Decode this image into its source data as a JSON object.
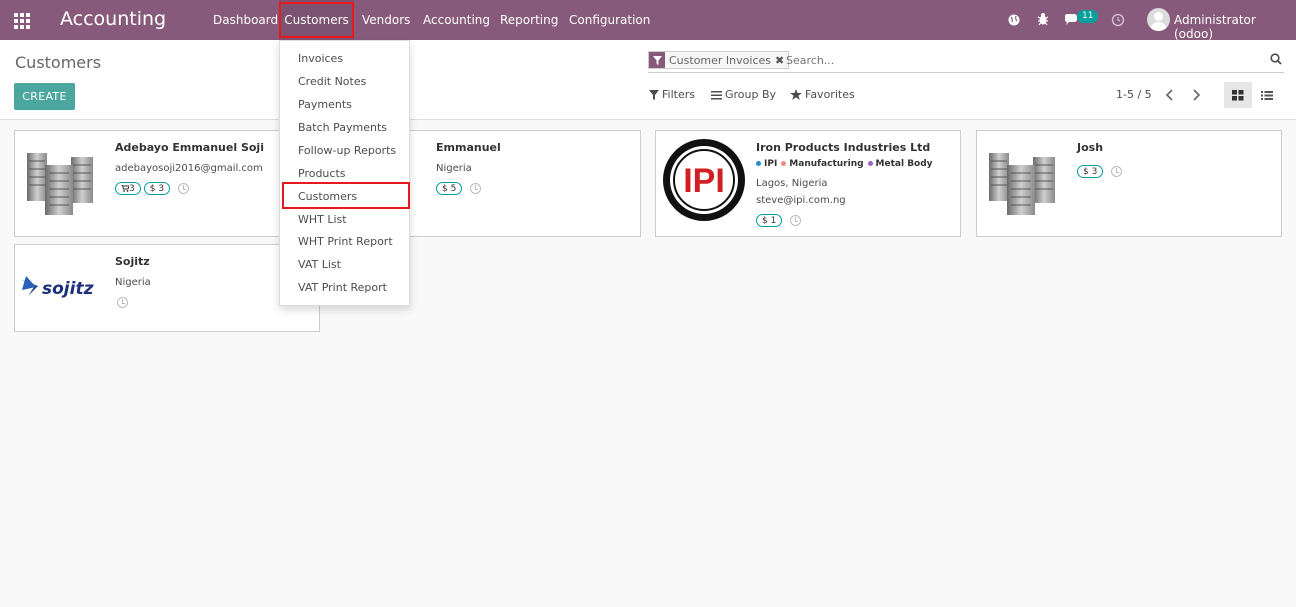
{
  "navbar": {
    "app_title": "Accounting",
    "menus": [
      "Dashboard",
      "Customers",
      "Vendors",
      "Accounting",
      "Reporting",
      "Configuration"
    ],
    "active_menu": "Customers",
    "messages_count": "11",
    "user": "Administrator (odoo)"
  },
  "control_panel": {
    "title": "Customers",
    "create_label": "CREATE",
    "facet_label": "Customer Invoices",
    "search_placeholder": "Search...",
    "filters_label": "Filters",
    "group_by_label": "Group By",
    "favorites_label": "Favorites",
    "pager": "1-5 / 5"
  },
  "dropdown": {
    "items": [
      "Invoices",
      "Credit Notes",
      "Payments",
      "Batch Payments",
      "Follow-up Reports",
      "Products",
      "Customers",
      "WHT List",
      "WHT Print Report",
      "VAT List",
      "VAT Print Report"
    ],
    "highlighted": "Customers"
  },
  "cards": [
    {
      "name": "Adebayo Emmanuel Soji",
      "email": "adebayosoji2016@gmail.com",
      "cart_count": "3",
      "invoice_badge": "$ 3"
    },
    {
      "name": "Emmanuel",
      "location": "Nigeria",
      "invoice_badge": "$ 5"
    },
    {
      "name": "Iron Products Industries Ltd",
      "tags": [
        "IPI",
        "Manufacturing",
        "Metal Body"
      ],
      "location": "Lagos, Nigeria",
      "email": "steve@ipi.com.ng",
      "invoice_badge": "$ 1",
      "logo_text": "IPI"
    },
    {
      "name": "Josh",
      "invoice_badge": "$ 3"
    },
    {
      "name": "Sojitz",
      "location": "Nigeria",
      "logo_text": "sojitz"
    }
  ],
  "colors": {
    "navbar": "#875a7b",
    "accent": "#00a09d",
    "highlight": "#e5191e"
  }
}
